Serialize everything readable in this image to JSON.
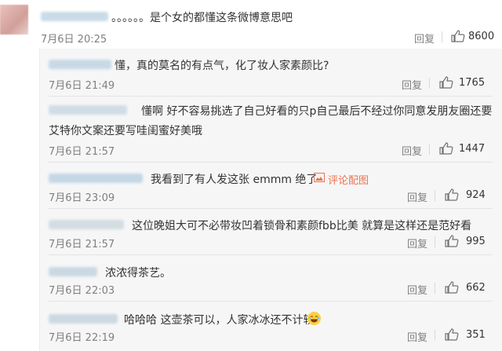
{
  "main_comment": {
    "text": "。。。。。。是个女的都懂这条微博意思吧",
    "time": "7月6日 20:25",
    "reply_label": "回复",
    "likes": "8600"
  },
  "replies": [
    {
      "text": "懂，真的莫名的有点气，化了妆人家素颜比?",
      "time": "7月6日 21:49",
      "reply_label": "回复",
      "likes": "1765"
    },
    {
      "text_line1": "懂啊 好不容易挑选了自己好看的只p自己最后不经过你同意发朋友圈还要",
      "text_line2": "艾特你文案还要写哇闺蜜好美哦",
      "time": "7月6日 21:57",
      "reply_label": "回复",
      "likes": "1447"
    },
    {
      "text": "我看到了有人发这张 emmm 绝了",
      "link": "评论配图",
      "time": "7月6日 23:09",
      "reply_label": "回复",
      "likes": "924"
    },
    {
      "text": "这位晚姐大可不必带妆凹着锁骨和素颜fbb比美 就算是这样还是范好看",
      "time": "7月6日 21:57",
      "reply_label": "回复",
      "likes": "995"
    },
    {
      "text": "浓浓得茶艺。",
      "time": "7月6日 22:03",
      "reply_label": "回复",
      "likes": "662"
    },
    {
      "text": "哈哈哈 这壶茶可以，人家冰冰还不计较",
      "time": "7月6日 22:19",
      "reply_label": "回复",
      "likes": "351"
    }
  ],
  "colors": {
    "link": "#eb7350",
    "muted": "#808080",
    "reply_bg": "#f6f6f6"
  },
  "icons": [
    "thumbs-up-icon",
    "picture-icon",
    "laughing-emoji-icon"
  ]
}
